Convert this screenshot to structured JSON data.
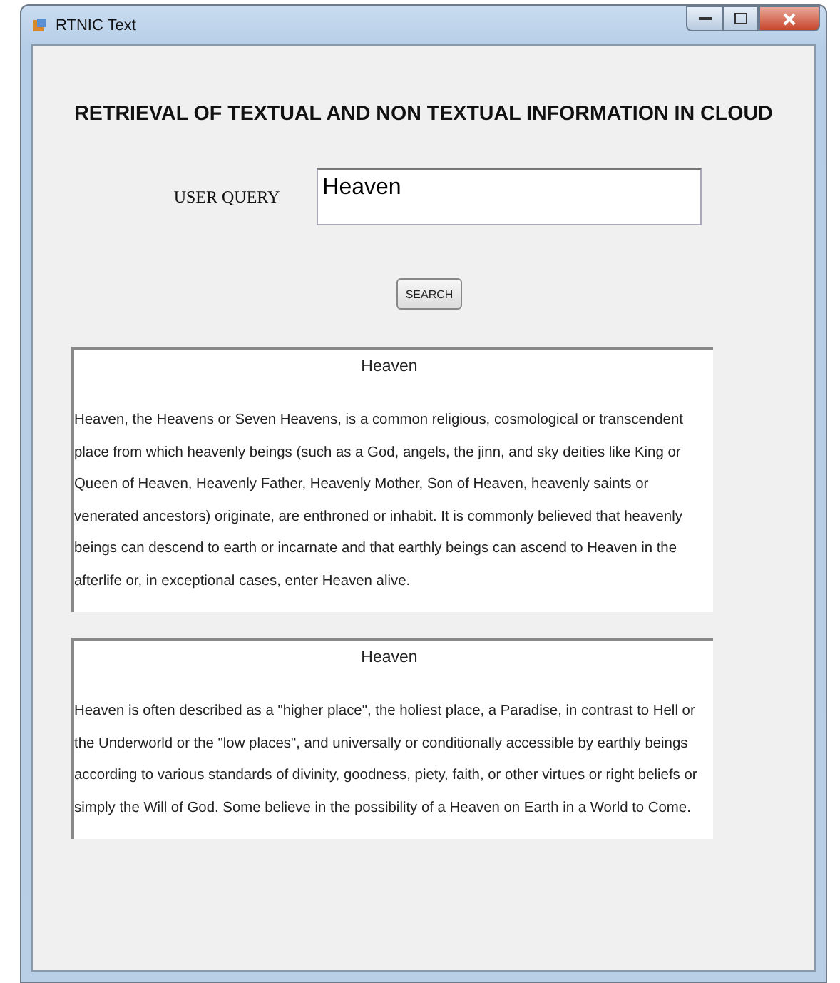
{
  "window": {
    "title": "RTNIC Text"
  },
  "heading": "RETRIEVAL OF TEXTUAL AND NON TEXTUAL INFORMATION IN CLOUD",
  "query": {
    "label": "USER QUERY",
    "value": "Heaven"
  },
  "search_button": "SEARCH",
  "results": [
    {
      "title": "Heaven",
      "body": "Heaven, the Heavens or Seven Heavens, is a common religious, cosmological or transcendent place from which heavenly beings (such as a God, angels, the jinn, and sky deities like King or Queen of Heaven, Heavenly Father, Heavenly Mother, Son of Heaven, heavenly saints or venerated ancestors) originate, are enthroned or inhabit. It is commonly believed that heavenly beings can descend to earth or incarnate and that earthly beings can ascend to Heaven in the afterlife or, in exceptional cases, enter Heaven alive."
    },
    {
      "title": "Heaven",
      "body": "Heaven is often described as a \"higher place\", the holiest place, a Paradise, in contrast to Hell or the Underworld or the \"low places\", and universally or conditionally accessible by earthly beings according to various standards of divinity, goodness, piety, faith, or other virtues or right beliefs or simply the Will of God. Some believe in the possibility of a Heaven on Earth in a World to Come."
    }
  ]
}
